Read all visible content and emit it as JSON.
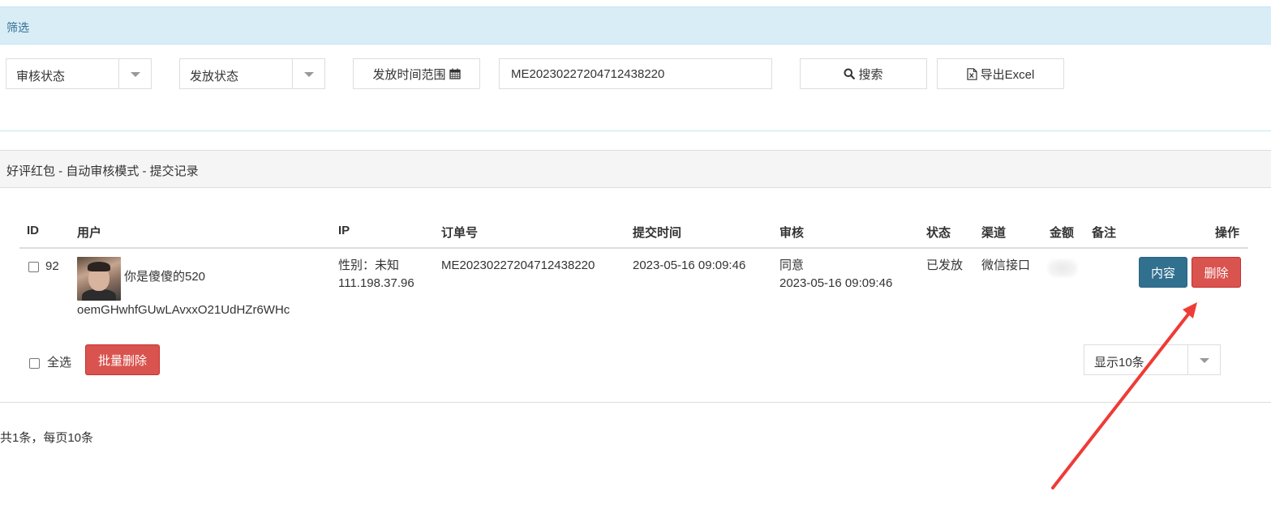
{
  "filter": {
    "title": "筛选",
    "audit_status": "审核状态",
    "send_status": "发放状态",
    "time_range_label": "发放时间范围",
    "search_value": "ME20230227204712438220",
    "search_button": "搜索",
    "export_button": "导出Excel"
  },
  "records": {
    "title": "好评红包 - 自动审核模式 - 提交记录",
    "columns": [
      "ID",
      "用户",
      "IP",
      "订单号",
      "提交时间",
      "审核",
      "状态",
      "渠道",
      "金额",
      "备注",
      "操作"
    ],
    "rows": [
      {
        "id": "92",
        "nickname": "你是傻傻的520",
        "openid": "oemGHwhfGUwLAvxxO21UdHZr6WHc",
        "gender": "性别：未知",
        "ip": "111.198.37.96",
        "order_no": "ME20230227204712438220",
        "submit_time": "2023-05-16 09:09:46",
        "audit_result": "同意",
        "audit_time": "2023-05-16 09:09:46",
        "status": "已发放",
        "channel": "微信接口",
        "amount": "",
        "remark": "",
        "content_button": "内容",
        "delete_button": "删除"
      }
    ],
    "select_all": "全选",
    "batch_delete": "批量删除",
    "page_size": "显示10条",
    "summary": "共1条，每页10条"
  },
  "colors": {
    "filter_header_bg": "#d9edf7",
    "info_button": "#31708f",
    "danger_button": "#d9534f",
    "annotation_arrow": "#ef3b36"
  }
}
